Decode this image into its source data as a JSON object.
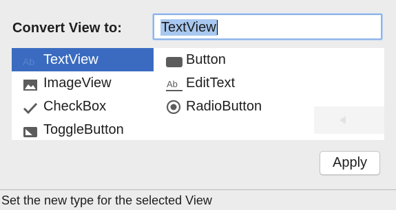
{
  "dialog": {
    "prompt_label": "Convert View to:",
    "name_field_value": "TextView",
    "apply_label": "Apply"
  },
  "view_types": [
    {
      "label": "TextView",
      "icon": "ab-icon",
      "selected": true
    },
    {
      "label": "ImageView",
      "icon": "image-icon",
      "selected": false
    },
    {
      "label": "CheckBox",
      "icon": "checkmark-icon",
      "selected": false
    },
    {
      "label": "ToggleButton",
      "icon": "toggle-icon",
      "selected": false
    },
    {
      "label": "Button",
      "icon": "button-icon",
      "selected": false
    },
    {
      "label": "EditText",
      "icon": "edittext-icon",
      "selected": false
    },
    {
      "label": "RadioButton",
      "icon": "radio-icon",
      "selected": false
    }
  ],
  "status_bar": {
    "text": "Set the new type for the selected View"
  },
  "colors": {
    "selection_background": "#3a6bc0",
    "text_selection_highlight": "#a8c8f0",
    "focus_ring": "#8eb3e8"
  }
}
